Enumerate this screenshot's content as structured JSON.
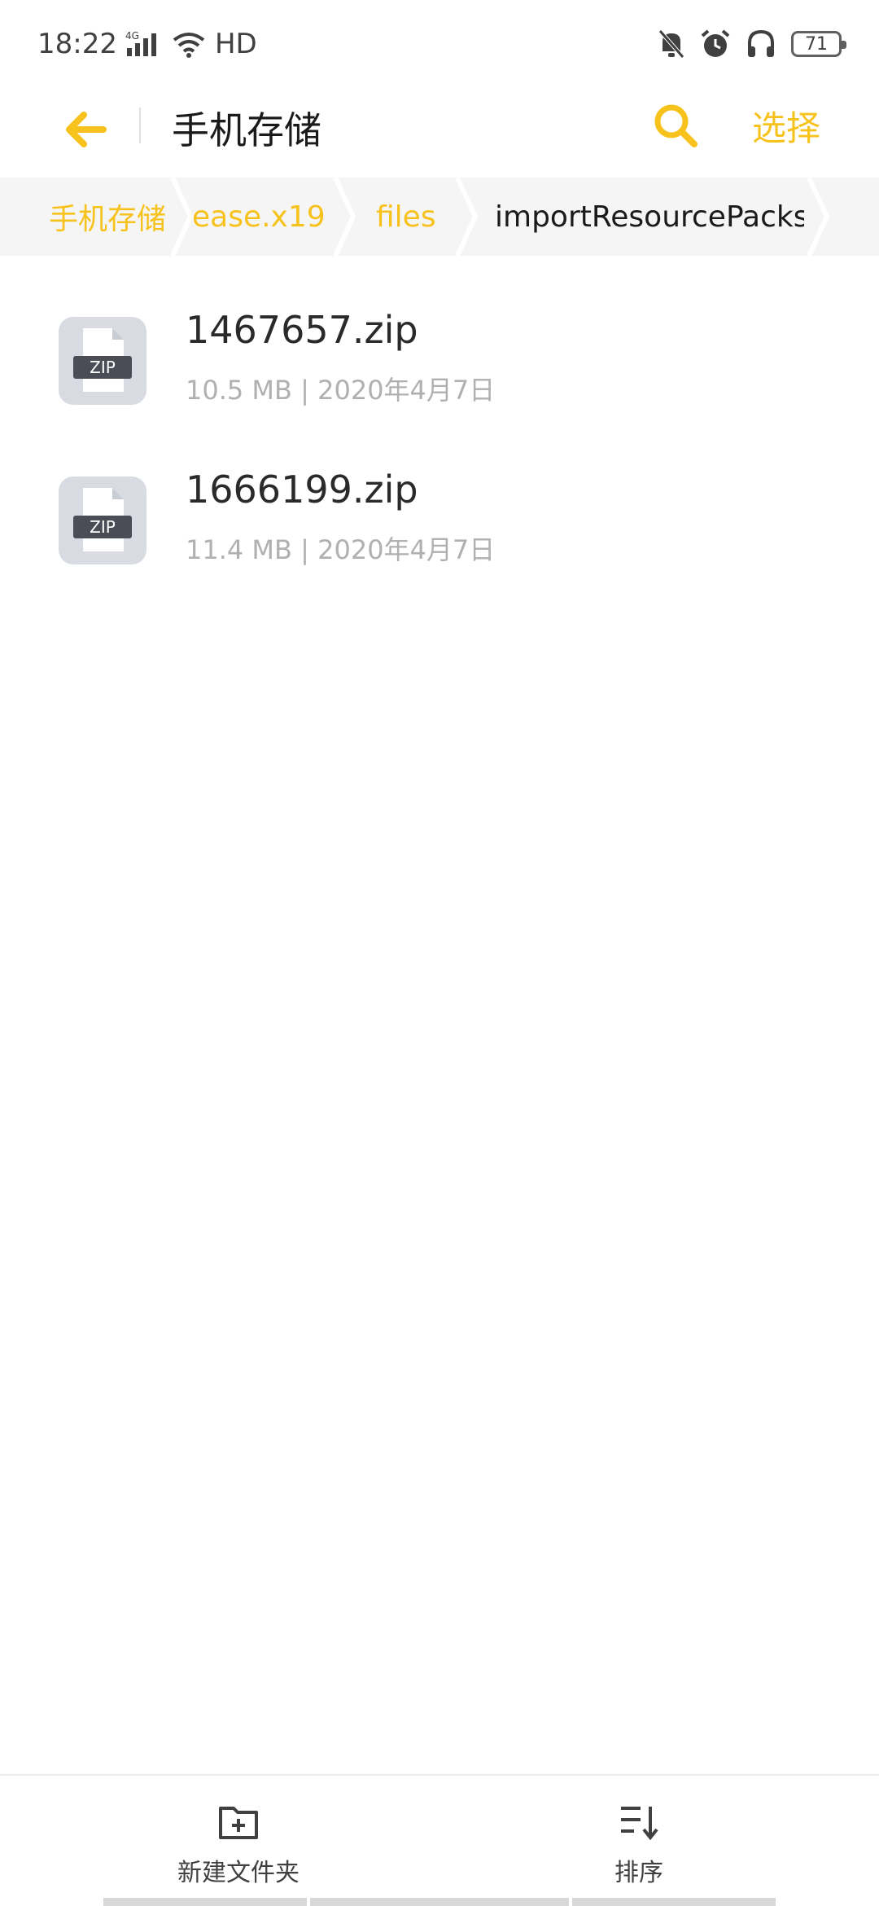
{
  "status_bar": {
    "time": "18:22",
    "network": "4G",
    "hd": "HD",
    "battery": "71"
  },
  "header": {
    "title": "手机存储",
    "select_label": "选择"
  },
  "breadcrumb": {
    "items": [
      {
        "label": "手机存储"
      },
      {
        "label": "ease.x19"
      },
      {
        "label": "files"
      },
      {
        "label": "importResourcePacks"
      }
    ]
  },
  "files": [
    {
      "name": "1467657.zip",
      "meta": "10.5 MB | 2020年4月7日",
      "badge": "ZIP"
    },
    {
      "name": "1666199.zip",
      "meta": "11.4 MB | 2020年4月7日",
      "badge": "ZIP"
    }
  ],
  "bottom_bar": {
    "new_folder": "新建文件夹",
    "sort": "排序"
  },
  "colors": {
    "accent": "#f7c21c",
    "text": "#1a1a1a",
    "meta": "#b0b0b0"
  }
}
